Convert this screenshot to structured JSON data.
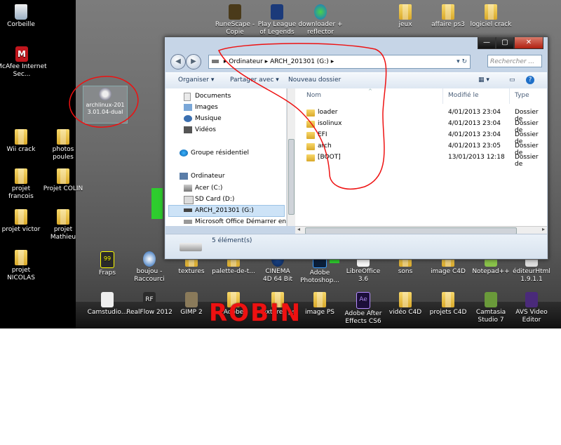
{
  "desktop": {
    "left_icons": [
      {
        "label": "Corbeille",
        "icon": "recycle-bin-icon"
      },
      {
        "label": "McAfee Internet Sec...",
        "icon": "mcafee-icon"
      },
      {
        "label": "Wii crack",
        "icon": "folder-icon"
      },
      {
        "label": "photos poules",
        "icon": "folder-icon"
      },
      {
        "label": "projet francois",
        "icon": "folder-icon"
      },
      {
        "label": "Projet COLIN",
        "icon": "folder-icon"
      },
      {
        "label": "projet victor",
        "icon": "folder-icon"
      },
      {
        "label": "projet Mathieu",
        "icon": "folder-icon"
      },
      {
        "label": "projet NICOLAS",
        "icon": "folder-icon"
      }
    ],
    "iso_file": {
      "label": "archlinux-2013.01.04-dual",
      "icon": "iso-disc-icon"
    },
    "top_icons": [
      {
        "label": "RuneScape - Copie",
        "icon": "runescape-icon"
      },
      {
        "label": "Play League of Legends",
        "icon": "league-icon"
      },
      {
        "label": "downloader + reflector",
        "icon": "downloader-icon"
      },
      {
        "label": "jeux",
        "icon": "folder-icon"
      },
      {
        "label": "affaire ps3",
        "icon": "folder-icon"
      },
      {
        "label": "logiciel crack",
        "icon": "folder-icon"
      }
    ],
    "row1_icons": [
      {
        "label": "Fraps",
        "icon": "fraps-icon"
      },
      {
        "label": "boujou - Raccourci",
        "icon": "boujou-icon"
      },
      {
        "label": "textures",
        "icon": "folder-icon"
      },
      {
        "label": "palette-de-t...",
        "icon": "folder-icon"
      },
      {
        "label": "CINEMA 4D 64 Bit",
        "icon": "cinema4d-icon"
      },
      {
        "label": "Adobe Photoshop...",
        "icon": "photoshop-icon"
      },
      {
        "label": "LibreOffice 3.6",
        "icon": "libreoffice-icon"
      },
      {
        "label": "sons",
        "icon": "folder-icon"
      },
      {
        "label": "image C4D",
        "icon": "folder-icon"
      },
      {
        "label": "Notepad++",
        "icon": "notepad-icon"
      },
      {
        "label": "éditeurHtml 1.9.1.1",
        "icon": "editor-icon"
      }
    ],
    "row2_icons": [
      {
        "label": "Camstudio...",
        "icon": "camstudio-icon"
      },
      {
        "label": "RealFlow 2012",
        "icon": "realflow-icon"
      },
      {
        "label": "GIMP 2",
        "icon": "gimp-icon"
      },
      {
        "label": "Adobe",
        "icon": "folder-icon"
      },
      {
        "label": "textures ps",
        "icon": "folder-icon"
      },
      {
        "label": "image PS",
        "icon": "folder-icon"
      },
      {
        "label": "Adobe After Effects CS6",
        "icon": "aftereffects-icon"
      },
      {
        "label": "vidéo C4D",
        "icon": "folder-icon"
      },
      {
        "label": "projets C4D",
        "icon": "folder-icon"
      },
      {
        "label": "Camtasia Studio 7",
        "icon": "camtasia-icon"
      },
      {
        "label": "AVS Video Editor",
        "icon": "avs-icon"
      }
    ],
    "watermark": "ROBIN"
  },
  "explorer": {
    "window_buttons": {
      "minimize": "—",
      "maximize": "▢",
      "close": "✕"
    },
    "address": {
      "root": "Ordinateur",
      "current": "ARCH_201301 (G:)"
    },
    "search_placeholder": "Rechercher ...",
    "toolbar": {
      "organize": "Organiser ▾",
      "share": "Partager avec ▾",
      "new_folder": "Nouveau dossier"
    },
    "nav": {
      "libraries": [
        "Documents",
        "Images",
        "Musique",
        "Vidéos"
      ],
      "homegroup": "Groupe résidentiel",
      "computer": "Ordinateur",
      "drives": [
        "Acer (C:)",
        "SD Card (D:)",
        "ARCH_201301 (G:)",
        "Microsoft Office Démarrer en u"
      ]
    },
    "columns": {
      "name": "Nom",
      "modified": "Modifié le",
      "type": "Type"
    },
    "files": [
      {
        "name": "loader",
        "modified": "4/01/2013 23:04",
        "type": "Dossier de"
      },
      {
        "name": "isolinux",
        "modified": "4/01/2013 23:04",
        "type": "Dossier de"
      },
      {
        "name": "EFI",
        "modified": "4/01/2013 23:04",
        "type": "Dossier de"
      },
      {
        "name": "arch",
        "modified": "4/01/2013 23:05",
        "type": "Dossier de"
      },
      {
        "name": "[BOOT]",
        "modified": "13/01/2013 12:18",
        "type": "Dossier de"
      }
    ],
    "status": "5 élément(s)"
  }
}
